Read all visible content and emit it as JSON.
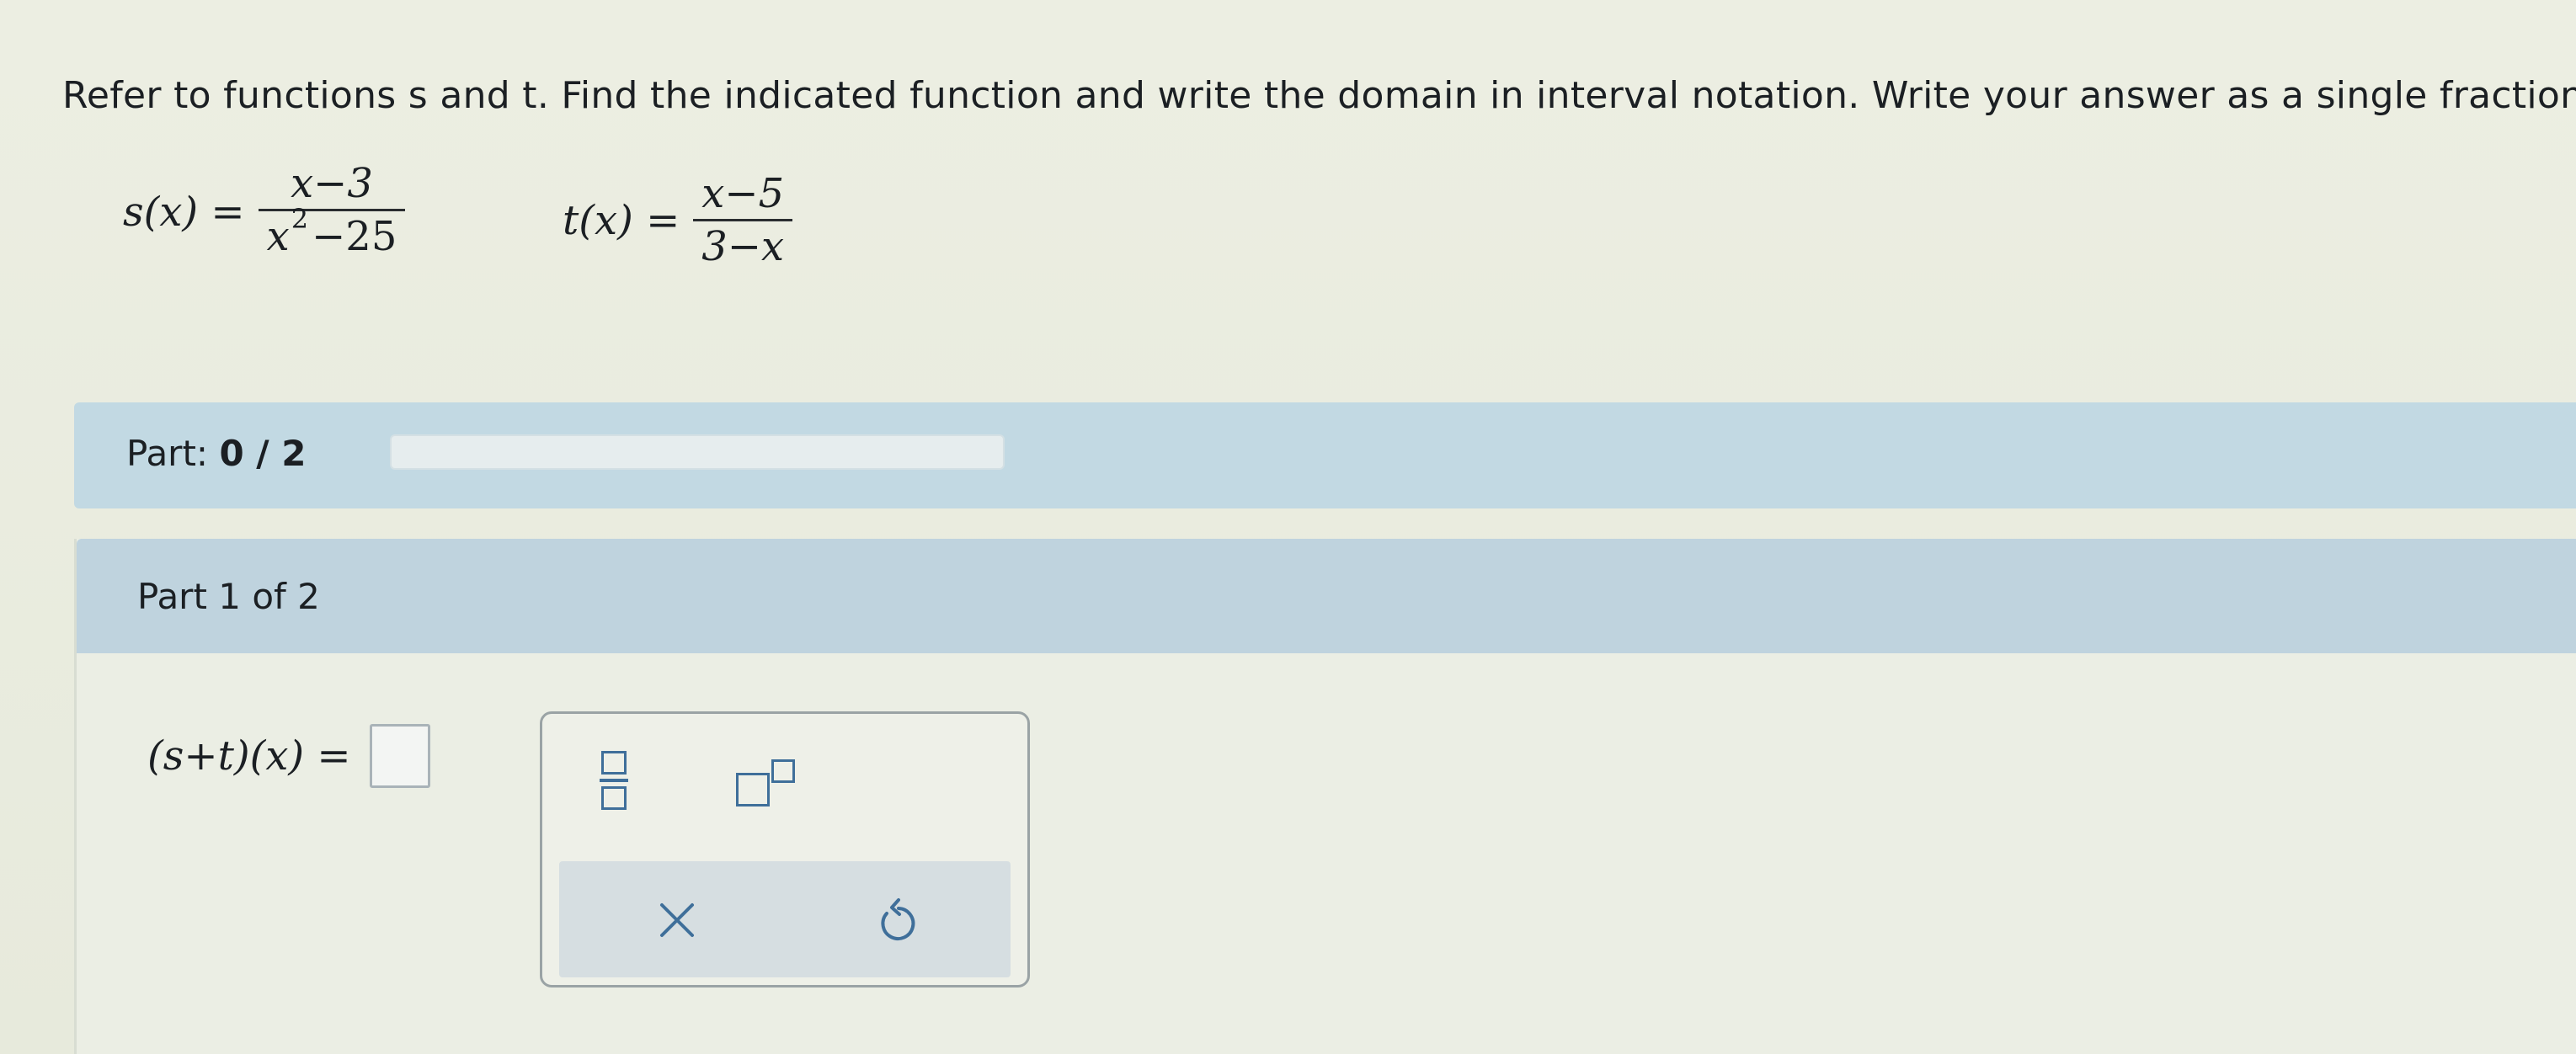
{
  "problem": {
    "instructions": "Refer to functions s and t. Find the indicated function and write the domain in interval notation. Write your answer as a single fraction.",
    "s_function": {
      "lhs": "s(x) =",
      "numerator": "x−3",
      "denominator_base": "x",
      "denominator_exp": "2",
      "denominator_rest": "−25"
    },
    "t_function": {
      "lhs": "t(x) =",
      "numerator": "x−5",
      "denominator": "3−x"
    }
  },
  "progress": {
    "label": "Part:",
    "value_text": "0 / 2",
    "completed": 0,
    "total": 2
  },
  "part": {
    "title": "Part 1 of 2",
    "expression": "(s+t)(x) ="
  },
  "palette": {
    "tools": [
      "fraction-icon",
      "exponent-icon"
    ],
    "actions": [
      "clear-icon",
      "undo-icon"
    ]
  },
  "colors": {
    "progress_bar_bg": "#c2d9e3",
    "card_header_bg": "#bfd3de",
    "icon_color": "#3f6f9a"
  }
}
